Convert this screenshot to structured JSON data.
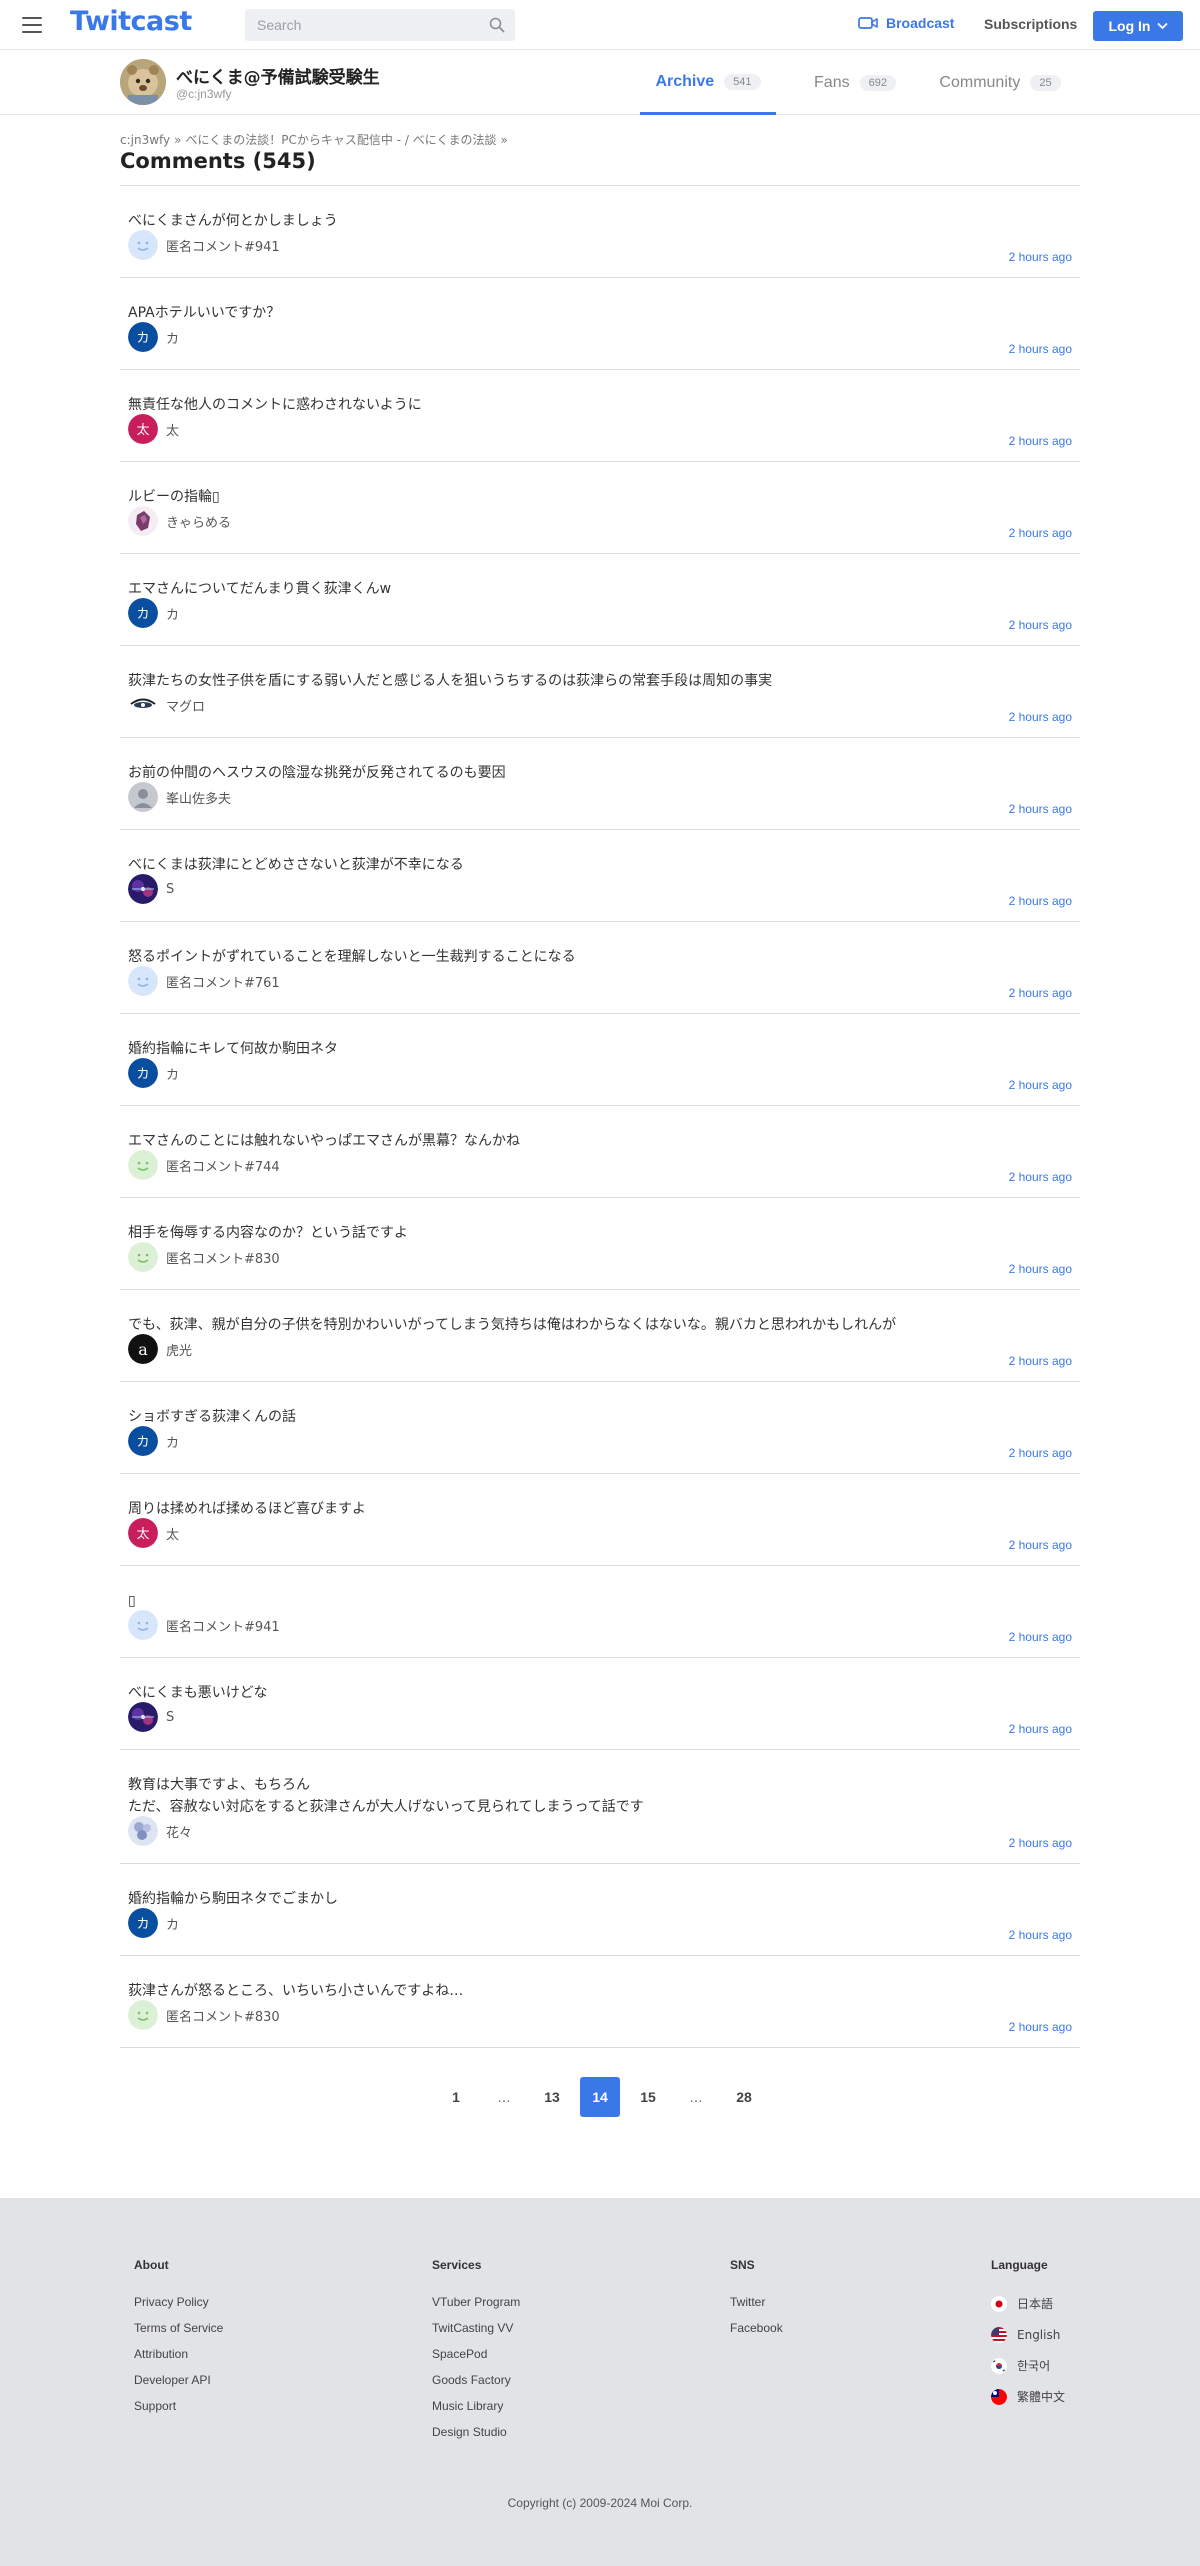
{
  "header": {
    "logo": "Twitcast",
    "search_placeholder": "Search",
    "broadcast_label": "Broadcast",
    "subscriptions_label": "Subscriptions",
    "login_label": "Log In",
    "accent_color": "#3b78e7"
  },
  "profile": {
    "name": "べにくま@予備試験受験生",
    "handle": "@c:jn3wfy",
    "tabs": [
      {
        "label": "Archive",
        "count": "541",
        "active": true
      },
      {
        "label": "Fans",
        "count": "692",
        "active": false
      },
      {
        "label": "Community",
        "count": "25",
        "active": false
      }
    ]
  },
  "breadcrumb": [
    "c:jn3wfy",
    "べにくまの法談！PCからキャス配信中 - / べにくまの法談"
  ],
  "page_title": "Comments (545)",
  "comments": [
    {
      "text": "べにくまさんが何とかしましょう",
      "user": "匿名コメント#941",
      "time": "2 hours ago",
      "avatar": "smile-blue"
    },
    {
      "text": "APAホテルいいですか？",
      "user": "カ",
      "time": "2 hours ago",
      "avatar": "letter-ka"
    },
    {
      "text": "無責任な他人のコメントに惑わされないように",
      "user": "太",
      "time": "2 hours ago",
      "avatar": "letter-ta"
    },
    {
      "text": "ルビーの指輪▯",
      "user": "きゃらめる",
      "time": "2 hours ago",
      "avatar": "gem"
    },
    {
      "text": "エマさんについてだんまり貫く荻津くんw",
      "user": "カ",
      "time": "2 hours ago",
      "avatar": "letter-ka"
    },
    {
      "text": "荻津たちの女性子供を盾にする弱い人だと感じる人を狙いうちするのは荻津らの常套手段は周知の事実",
      "user": "マグロ",
      "time": "2 hours ago",
      "avatar": "eye"
    },
    {
      "text": "お前の仲間のヘスウスの陰湿な挑発が反発されてるのも要因",
      "user": "峯山佐多夫",
      "time": "2 hours ago",
      "avatar": "default"
    },
    {
      "text": "べにくまは荻津にとどめささないと荻津が不幸になる",
      "user": "S",
      "time": "2 hours ago",
      "avatar": "galaxy"
    },
    {
      "text": "怒るポイントがずれていることを理解しないと一生裁判することになる",
      "user": "匿名コメント#761",
      "time": "2 hours ago",
      "avatar": "smile-blue"
    },
    {
      "text": "婚約指輪にキレて何故か駒田ネタ",
      "user": "カ",
      "time": "2 hours ago",
      "avatar": "letter-ka"
    },
    {
      "text": "エマさんのことには触れないやっぱエマさんが黒幕？なんかね",
      "user": "匿名コメント#744",
      "time": "2 hours ago",
      "avatar": "smile-green"
    },
    {
      "text": "相手を侮辱する内容なのか？という話ですよ",
      "user": "匿名コメント#830",
      "time": "2 hours ago",
      "avatar": "smile-green"
    },
    {
      "text": "でも、荻津、親が自分の子供を特別かわいいがってしまう気持ちは俺はわからなくはないな。親バカと思われかもしれんが",
      "user": "虎光",
      "time": "2 hours ago",
      "avatar": "tiger"
    },
    {
      "text": "ショボすぎる荻津くんの話",
      "user": "カ",
      "time": "2 hours ago",
      "avatar": "letter-ka"
    },
    {
      "text": "周りは揉めれば揉めるほど喜びますよ",
      "user": "太",
      "time": "2 hours ago",
      "avatar": "letter-ta"
    },
    {
      "text": "▯",
      "user": "匿名コメント#941",
      "time": "2 hours ago",
      "avatar": "smile-blue"
    },
    {
      "text": "べにくまも悪いけどな",
      "user": "S",
      "time": "2 hours ago",
      "avatar": "galaxy"
    },
    {
      "text": "教育は大事ですよ、もちろん\nただ、容赦ない対応をすると荻津さんが大人げないって見られてしまうって話です",
      "user": "花々",
      "time": "2 hours ago",
      "avatar": "flower"
    },
    {
      "text": "婚約指輪から駒田ネタでごまかし",
      "user": "カ",
      "time": "2 hours ago",
      "avatar": "letter-ka"
    },
    {
      "text": "荻津さんが怒るところ、いちいち小さいんですよね…",
      "user": "匿名コメント#830",
      "time": "2 hours ago",
      "avatar": "smile-green"
    }
  ],
  "pagination": [
    "1",
    "…",
    "13",
    "14",
    "15",
    "…",
    "28"
  ],
  "pagination_current": "14",
  "footer": {
    "about": {
      "title": "About",
      "links": [
        "Privacy Policy",
        "Terms of Service",
        "Attribution",
        "Developer API",
        "Support"
      ]
    },
    "services": {
      "title": "Services",
      "links": [
        "VTuber Program",
        "TwitCasting VV",
        "SpacePod",
        "Goods Factory",
        "Music Library",
        "Design Studio"
      ]
    },
    "sns": {
      "title": "SNS",
      "links": [
        "Twitter",
        "Facebook"
      ]
    },
    "language": {
      "title": "Language",
      "items": [
        {
          "label": "日本語",
          "flag": "japan-flag-icon"
        },
        {
          "label": "English",
          "flag": "us-flag-icon"
        },
        {
          "label": "한국어",
          "flag": "korea-flag-icon"
        },
        {
          "label": "繁體中文",
          "flag": "taiwan-flag-icon"
        }
      ]
    },
    "copyright": "Copyright (c) 2009-2024 Moi Corp."
  }
}
